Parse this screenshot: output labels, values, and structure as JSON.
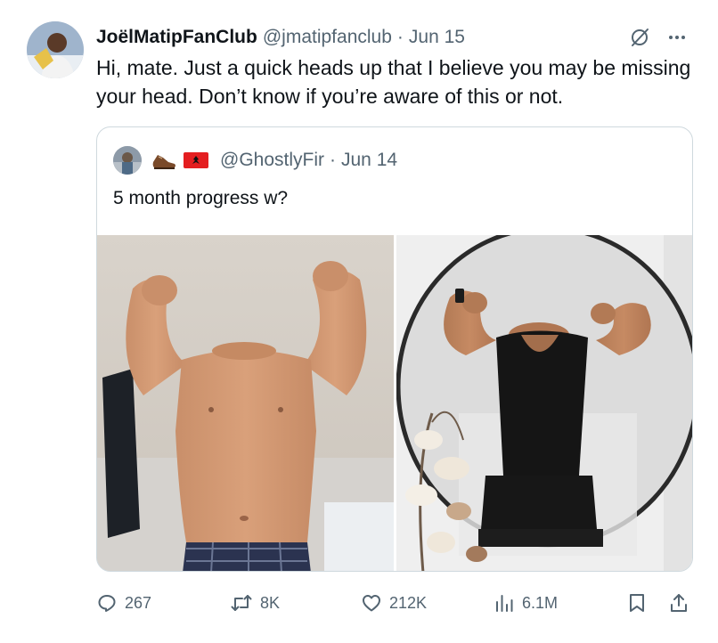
{
  "tweet": {
    "display_name": "JoëlMatipFanClub",
    "handle": "@jmatipfanclub",
    "separator": "·",
    "date": "Jun 15",
    "text": "Hi, mate. Just a quick heads up that I believe you may be missing your head. Don’t know if you’re aware of this or not."
  },
  "quote": {
    "handle": "@GhostlyFir",
    "separator": "·",
    "date": "Jun 14",
    "text": "5 month progress w?",
    "emojis": [
      "shoe-emoji",
      "albania-flag-emoji"
    ]
  },
  "icons": {
    "header": [
      "grok-icon",
      "more-icon"
    ],
    "actions": [
      "reply-icon",
      "retweet-icon",
      "like-icon",
      "views-icon",
      "bookmark-icon",
      "share-icon"
    ]
  },
  "actions": {
    "replies": "267",
    "retweets": "8K",
    "likes": "212K",
    "views": "6.1M"
  },
  "colors": {
    "text": "#0f1419",
    "secondary": "#536471",
    "border": "#cfd9de",
    "flag_red": "#e41e20"
  }
}
